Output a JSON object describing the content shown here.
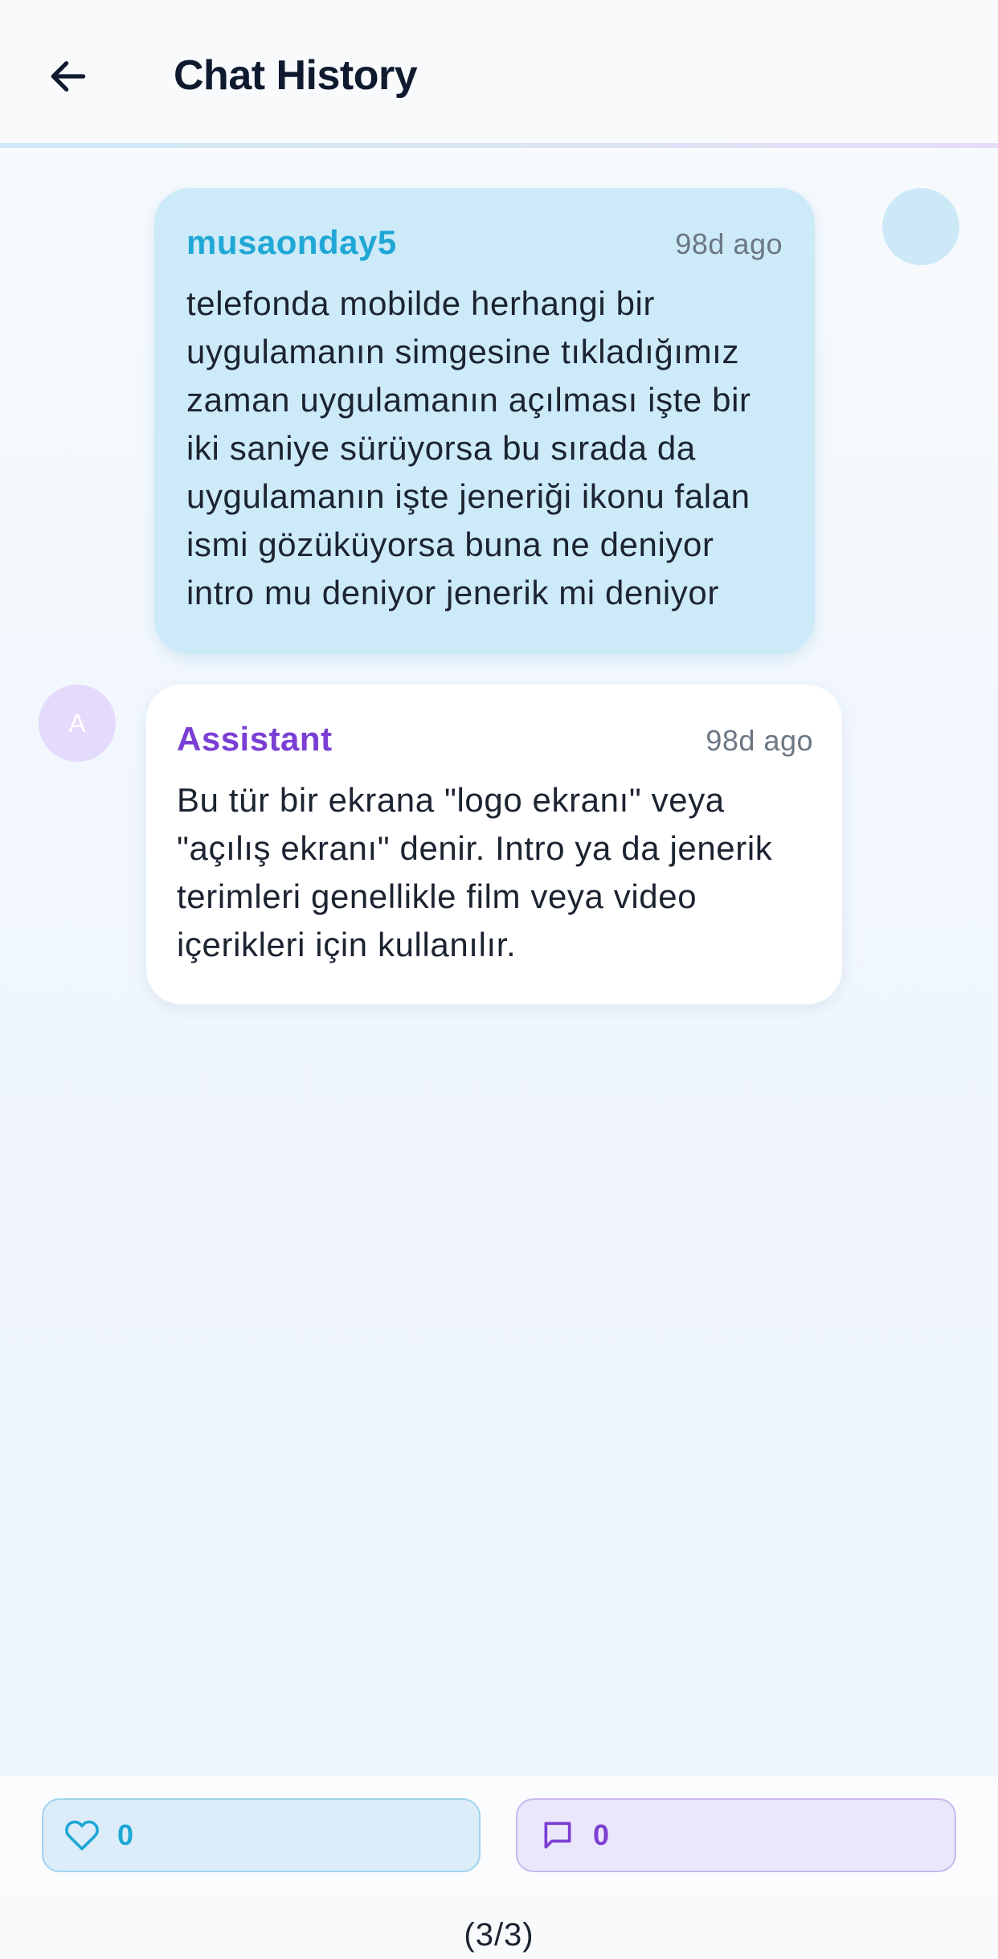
{
  "header": {
    "title": "Chat History",
    "back_icon": "arrow-left-icon"
  },
  "messages": [
    {
      "role": "user",
      "author": "musaonday5",
      "time": "98d ago",
      "text": "telefonda mobilde herhangi bir\nuygulamanın simgesine tıkladığımız\nzaman uygulamanın açılması işte bir\niki saniye sürüyorsa bu sırada da\nuygulamanın işte jeneriği ikonu falan\nismi gözüküyorsa buna ne deniyor\nintro mu deniyor jenerik mi deniyor"
    },
    {
      "role": "assistant",
      "author": "Assistant",
      "avatar_letter": "A",
      "time": "98d ago",
      "text": "Bu tür bir ekrana \"logo ekranı\" veya\n\"açılış ekranı\" denir. Intro ya da jenerik\nterimleri genellikle film veya video\niçerikleri için kullanılır."
    }
  ],
  "actions": {
    "likes": "0",
    "comments": "0",
    "like_icon": "heart-icon",
    "comment_icon": "comment-icon"
  },
  "pagination": "(3/3)",
  "colors": {
    "user_accent": "#1fa7d6",
    "assistant_accent": "#7b3fd4",
    "user_bubble": "#cdeaf8"
  }
}
